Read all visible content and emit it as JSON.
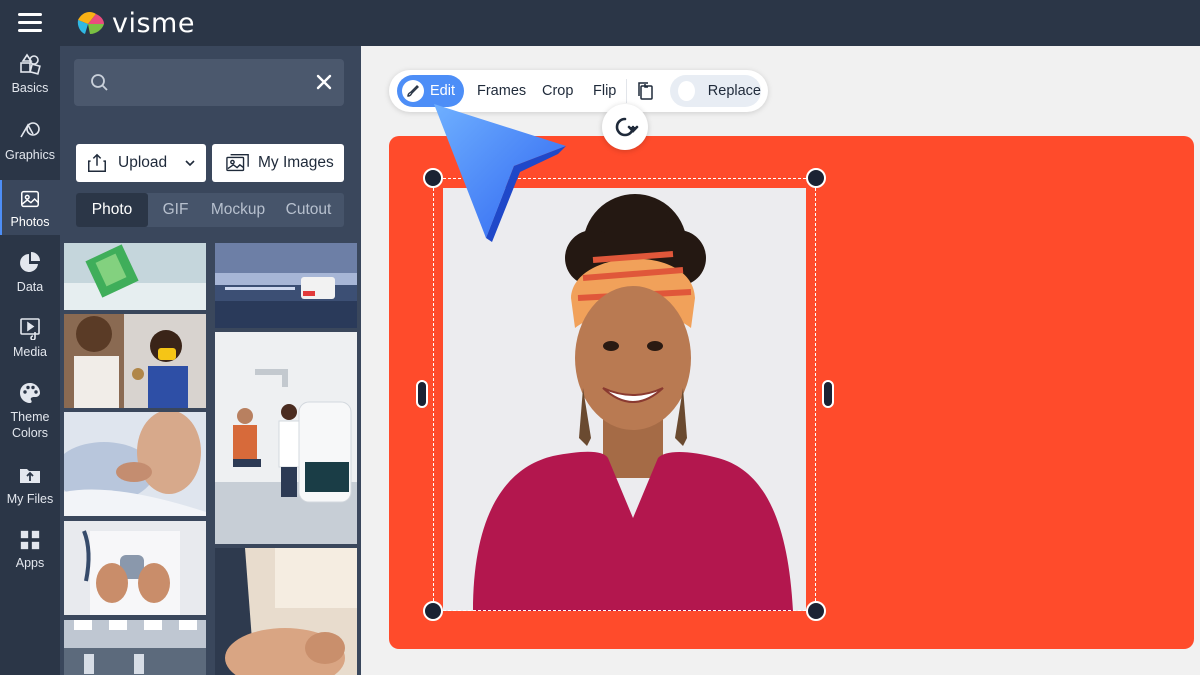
{
  "app": {
    "logo_text": "visme"
  },
  "rail": {
    "items": [
      {
        "id": "basics",
        "label": "Basics"
      },
      {
        "id": "graphics",
        "label": "Graphics"
      },
      {
        "id": "photos",
        "label": "Photos",
        "active": true
      },
      {
        "id": "data",
        "label": "Data"
      },
      {
        "id": "media",
        "label": "Media"
      },
      {
        "id": "theme",
        "label": "Theme Colors"
      },
      {
        "id": "files",
        "label": "My Files"
      },
      {
        "id": "apps",
        "label": "Apps"
      }
    ]
  },
  "panel": {
    "search": {
      "value": "",
      "placeholder": ""
    },
    "upload_label": "Upload",
    "my_images_label": "My Images",
    "tabs": [
      "Photo",
      "GIF",
      "Mockup",
      "Cutout"
    ],
    "active_tab": "Photo"
  },
  "toolbar": {
    "edit_label": "Edit",
    "frames_label": "Frames",
    "crop_label": "Crop",
    "flip_label": "Flip",
    "replace_label": "Replace"
  },
  "colors": {
    "chrome": "#2b3647",
    "panel": "#3a475c",
    "accent": "#4d8ef7",
    "canvas": "#ff4b2b"
  },
  "icons": [
    "menu-icon",
    "visme-logo-icon",
    "basics-icon",
    "graphics-icon",
    "photos-icon",
    "data-icon",
    "media-icon",
    "theme-colors-icon",
    "my-files-icon",
    "apps-icon",
    "search-icon",
    "close-icon",
    "upload-icon",
    "chevron-down-icon",
    "images-icon",
    "brush-icon",
    "copy-icon",
    "rotate-icon",
    "pointer-cursor-icon"
  ]
}
